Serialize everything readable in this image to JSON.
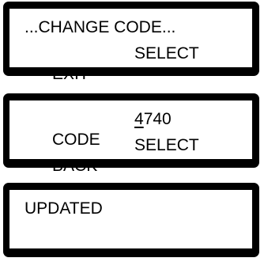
{
  "screens": [
    {
      "line1": "...CHANGE CODE...",
      "left_label": "EXIT",
      "right_label": "SELECT"
    },
    {
      "field_label": "CODE",
      "code_cursor_digit": "4",
      "code_rest": "740",
      "left_label": "BACK",
      "right_label": "SELECT"
    },
    {
      "message": "UPDATED"
    }
  ]
}
